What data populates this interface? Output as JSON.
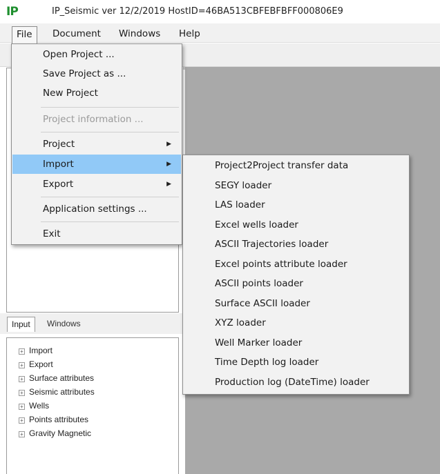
{
  "titlebar": {
    "logo": "IP",
    "title": "IP_Seismic ver 12/2/2019    HostID=46BA513CBFEBFBFF000806E9"
  },
  "menubar": {
    "file": "File",
    "document": "Document",
    "windows": "Windows",
    "help": "Help"
  },
  "file_menu": {
    "open_project": "Open Project ...",
    "save_project_as": "Save Project as ...",
    "new_project": "New Project",
    "project_information": "Project information ...",
    "project": "Project",
    "import": "Import",
    "export": "Export",
    "application_settings": "Application settings ...",
    "exit": "Exit"
  },
  "import_menu": {
    "items": [
      "Project2Project transfer data",
      "SEGY loader",
      "LAS loader",
      "Excel wells loader",
      "ASCII Trajectories loader",
      "Excel points attribute loader",
      "ASCII points loader",
      "Surface ASCII loader",
      "XYZ loader",
      "Well Marker loader",
      "Time Depth log loader",
      "Production log (DateTime) loader"
    ]
  },
  "tabs": {
    "input": "Input",
    "windows": "Windows"
  },
  "tree": {
    "items": [
      "Import",
      "Export",
      "Surface attributes",
      "Seismic attributes",
      "Wells",
      "Points attributes",
      "Gravity Magnetic"
    ]
  },
  "colors": {
    "highlight": "#91c9f7",
    "workspace": "#a9a9a9",
    "logo": "#1f8f2f"
  }
}
